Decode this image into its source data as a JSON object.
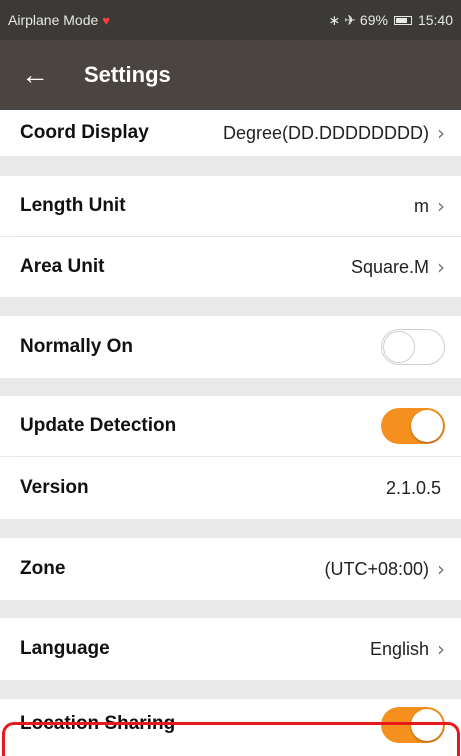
{
  "status_bar": {
    "left_text": "Airplane Mode",
    "battery": "69%",
    "time": "15:40",
    "icons": [
      "heart-icon",
      "bluetooth-icon",
      "airplane-icon",
      "battery-icon"
    ]
  },
  "app_bar": {
    "title": "Settings",
    "back_icon": "arrow-left-icon"
  },
  "settings": {
    "coord_display": {
      "label": "Coord Display",
      "value": "Degree(DD.DDDDDDDD)"
    },
    "length_unit": {
      "label": "Length Unit",
      "value": "m"
    },
    "area_unit": {
      "label": "Area Unit",
      "value": "Square.M"
    },
    "normally_on": {
      "label": "Normally On",
      "enabled": false
    },
    "update_detection": {
      "label": "Update Detection",
      "enabled": true
    },
    "version": {
      "label": "Version",
      "value": "2.1.0.5"
    },
    "zone": {
      "label": "Zone",
      "value": "(UTC+08:00)"
    },
    "language": {
      "label": "Language",
      "value": "English"
    },
    "location_sharing": {
      "label": "Location Sharing",
      "enabled": true
    }
  },
  "colors": {
    "accent": "#f5901e",
    "appbar": "#4a4540",
    "statusbar": "#3c3a37",
    "highlight": "#e8181c",
    "background": "#e9e9e9"
  }
}
